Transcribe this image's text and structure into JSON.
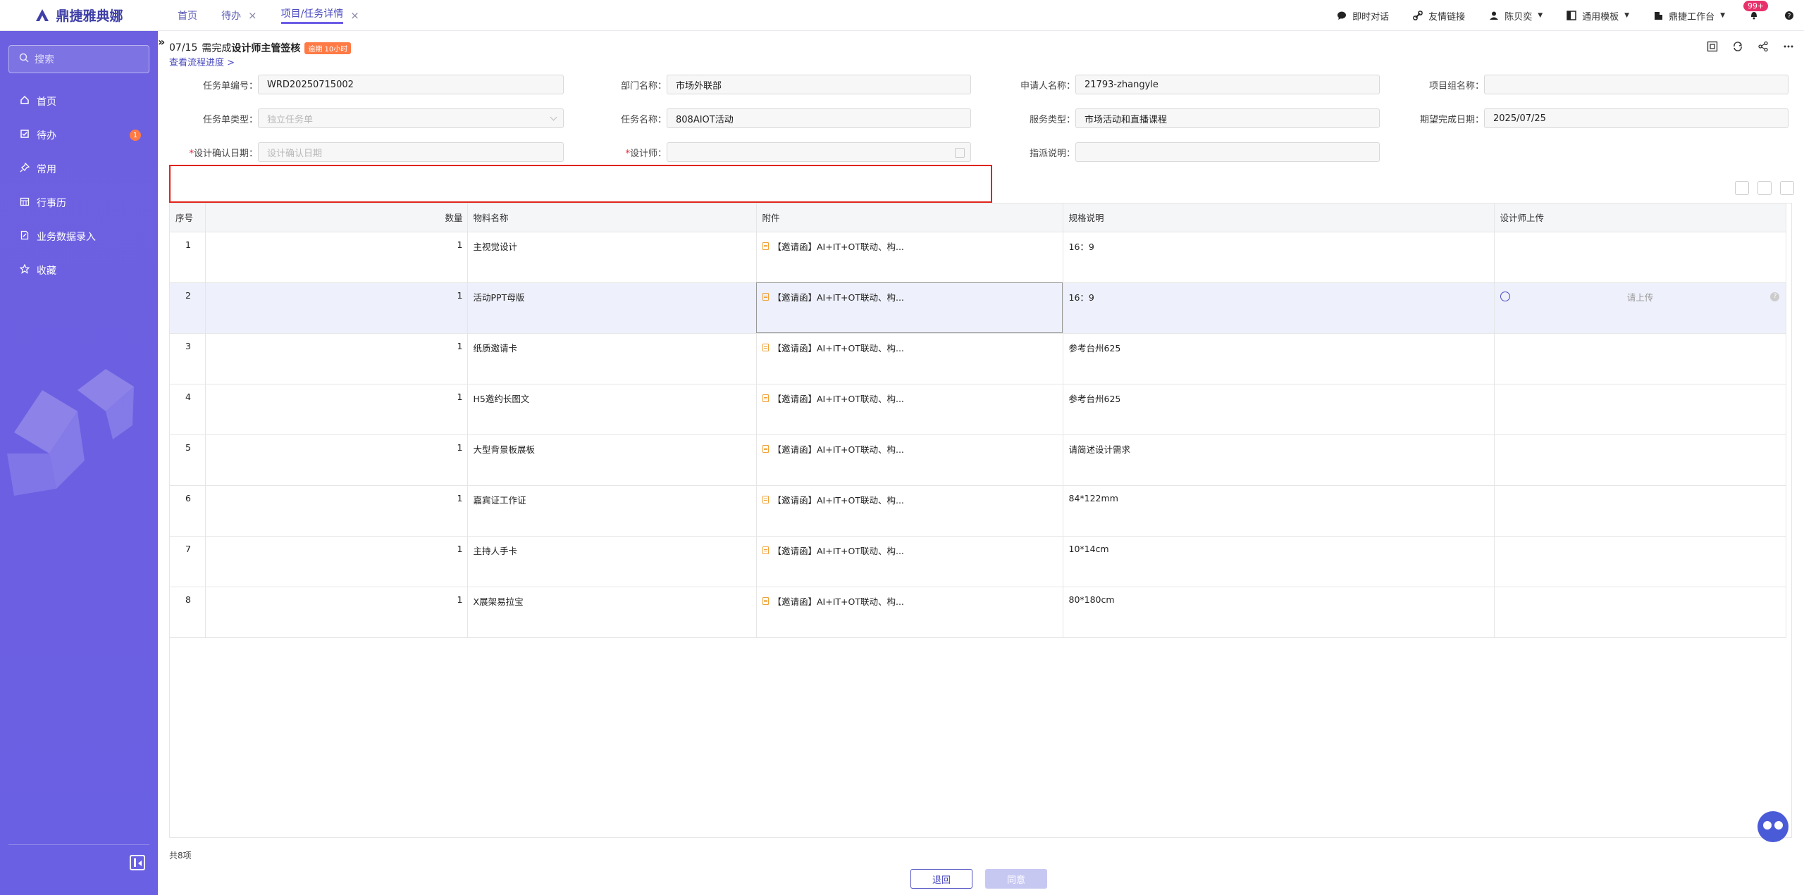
{
  "app": {
    "logo_text": "鼎捷雅典娜"
  },
  "tabs": [
    {
      "label": "首页",
      "closable": false
    },
    {
      "label": "待办",
      "closable": true
    },
    {
      "label": "项目/任务详情",
      "closable": true,
      "active": true
    }
  ],
  "tab_close": "×",
  "topbar": {
    "chat": "即时对话",
    "links": "友情链接",
    "user": "陈贝奕",
    "template": "通用模板",
    "workbench": "鼎捷工作台",
    "notify_count": "99+",
    "caret": "▼"
  },
  "sidebar": {
    "search_placeholder": "搜索",
    "items": [
      {
        "label": "首页",
        "icon": "home-icon"
      },
      {
        "label": "待办",
        "icon": "todo-icon",
        "badge": "1"
      },
      {
        "label": "常用",
        "icon": "pin-icon"
      },
      {
        "label": "行事历",
        "icon": "calendar-icon"
      },
      {
        "label": "业务数据录入",
        "icon": "data-entry-icon"
      },
      {
        "label": "收藏",
        "icon": "star-icon"
      }
    ]
  },
  "header": {
    "expand": "»",
    "date": "07/15",
    "title_pre": "需完成",
    "title_bold": "设计师主管签核",
    "overdue": "逾期 10小时",
    "flow_link": "查看流程进度 >"
  },
  "form": {
    "task_no": {
      "label": "任务单编号：",
      "value": "WRD20250715002"
    },
    "dept": {
      "label": "部门名称：",
      "value": "市场外联部"
    },
    "applicant": {
      "label": "申请人名称：",
      "value": "21793-zhangyle"
    },
    "project_group": {
      "label": "项目组名称：",
      "value": ""
    },
    "task_type": {
      "label": "任务单类型：",
      "value": "独立任务单"
    },
    "task_name": {
      "label": "任务名称：",
      "value": "808AIOT活动"
    },
    "service_type": {
      "label": "服务类型：",
      "value": "市场活动和直播课程"
    },
    "expected_date": {
      "label": "期望完成日期：",
      "value": "2025/07/25"
    },
    "design_confirm_date": {
      "label": "设计确认日期：",
      "placeholder": "设计确认日期"
    },
    "designer": {
      "label": "设计师：",
      "value": ""
    },
    "assign_note": {
      "label": "指派说明：",
      "value": ""
    },
    "required_mark": "*"
  },
  "table": {
    "headers": [
      "序号",
      "数量",
      "物料名称",
      "附件",
      "规格说明",
      "设计师上传"
    ],
    "upload_placeholder": "请上传",
    "help": "?",
    "rows": [
      {
        "idx": "1",
        "qty": "1",
        "name": "主视觉设计",
        "att": "【邀请函】AI+IT+OT联动、构...",
        "spec": "16：9"
      },
      {
        "idx": "2",
        "qty": "1",
        "name": "活动PPT母版",
        "att": "【邀请函】AI+IT+OT联动、构...",
        "spec": "16：9"
      },
      {
        "idx": "3",
        "qty": "1",
        "name": "纸质邀请卡",
        "att": "【邀请函】AI+IT+OT联动、构...",
        "spec": "参考台州625"
      },
      {
        "idx": "4",
        "qty": "1",
        "name": "H5邀约长图文",
        "att": "【邀请函】AI+IT+OT联动、构...",
        "spec": "参考台州625"
      },
      {
        "idx": "5",
        "qty": "1",
        "name": "大型背景板展板",
        "att": "【邀请函】AI+IT+OT联动、构...",
        "spec": "请简述设计需求"
      },
      {
        "idx": "6",
        "qty": "1",
        "name": "嘉宾证工作证",
        "att": "【邀请函】AI+IT+OT联动、构...",
        "spec": "84*122mm"
      },
      {
        "idx": "7",
        "qty": "1",
        "name": "主持人手卡",
        "att": "【邀请函】AI+IT+OT联动、构...",
        "spec": "10*14cm"
      },
      {
        "idx": "8",
        "qty": "1",
        "name": "X展架易拉宝",
        "att": "【邀请函】AI+IT+OT联动、构...",
        "spec": "80*180cm"
      }
    ]
  },
  "footer": {
    "total": "共8项",
    "back": "退回",
    "agree": "同意"
  },
  "colors": {
    "sidebar": "#6d60e0",
    "accent": "#4b4bc0",
    "required_outline": "#e0241b",
    "overdue": "#ff7a45"
  }
}
